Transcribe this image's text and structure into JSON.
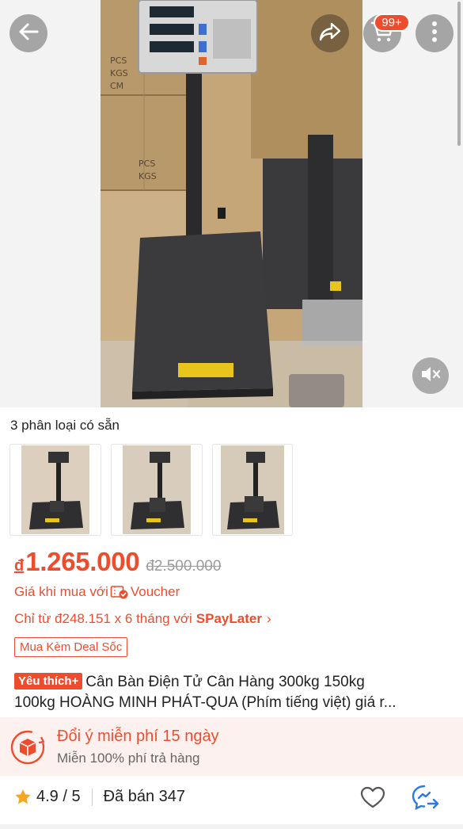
{
  "header": {
    "cart_badge": "99+"
  },
  "variants": {
    "title": "3 phân loại có sẵn",
    "items": [
      "variant-1",
      "variant-2",
      "variant-3"
    ]
  },
  "price": {
    "currency": "đ",
    "current": "1.265.000",
    "original": "đ2.500.000"
  },
  "voucher": {
    "prefix": "Giá khi mua với",
    "label": "Voucher"
  },
  "spaylater": {
    "text": "Chỉ từ đ248.151 x 6 tháng với",
    "brand": "SPayLater",
    "chevron": "›"
  },
  "deal_tag": "Mua Kèm Deal Sốc",
  "product": {
    "badge": "Yêu thích+",
    "title_line1": "Cân Bàn Điện Tử Cân Hàng 300kg 150kg",
    "title_line2": "100kg HOÀNG MINH PHÁT-QUA (Phím tiếng việt) giá r..."
  },
  "return_policy": {
    "title": "Đổi ý miễn phí 15 ngày",
    "subtitle": "Miễn 100% phí trả hàng"
  },
  "rating": {
    "score": "4.9 / 5",
    "sold": "Đã bán 347"
  },
  "colors": {
    "accent": "#ee4d2d",
    "star": "#f5a623",
    "chat": "#2a7be4"
  },
  "icons": [
    "back-arrow-icon",
    "share-icon",
    "cart-icon",
    "more-icon",
    "mute-icon",
    "voucher-icon",
    "chevron-right-icon",
    "return-box-icon",
    "star-icon",
    "heart-icon",
    "chat-icon"
  ]
}
